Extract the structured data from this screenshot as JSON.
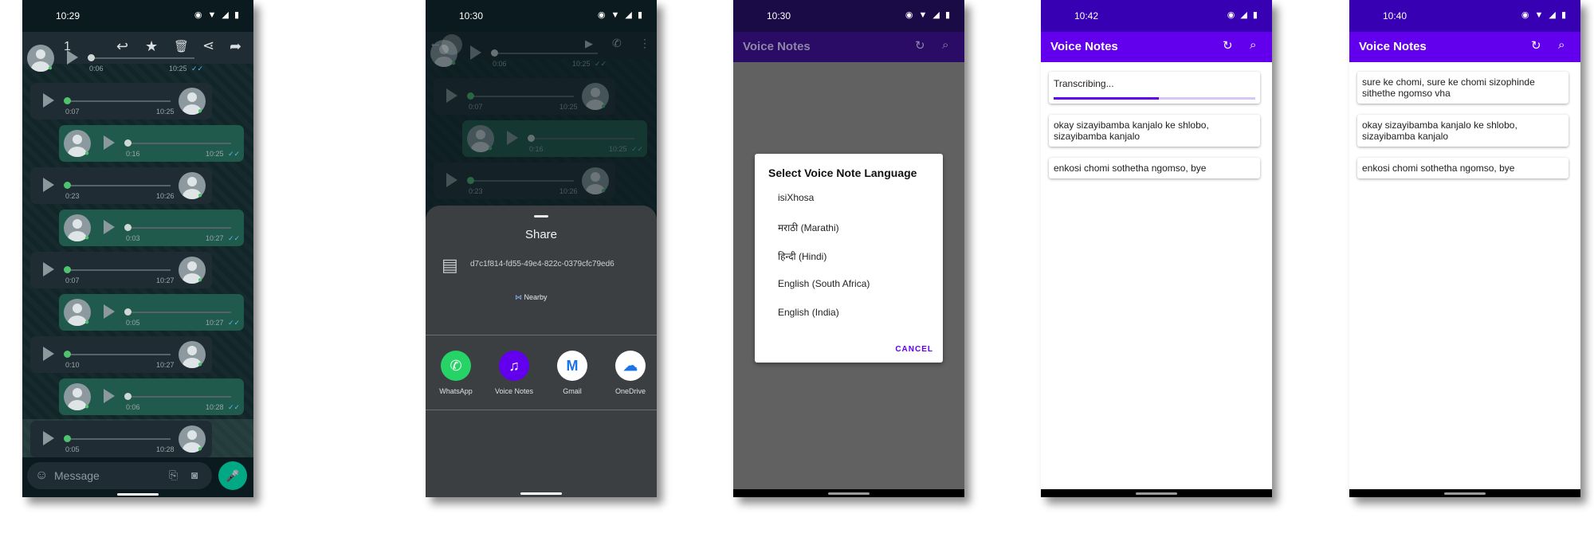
{
  "phone1": {
    "time": "10:29",
    "status_icons": "◉ ▼ ◢ ▮",
    "selected_count": "1",
    "message_placeholder": "Message",
    "partial_top": {
      "duration": "0:06",
      "time": "10:25"
    },
    "voice_notes": [
      {
        "dir": "in",
        "duration": "0:07",
        "time": "10:25"
      },
      {
        "dir": "out",
        "duration": "0:16",
        "time": "10:25"
      },
      {
        "dir": "in",
        "duration": "0:23",
        "time": "10:26"
      },
      {
        "dir": "out",
        "duration": "0:03",
        "time": "10:27"
      },
      {
        "dir": "in",
        "duration": "0:07",
        "time": "10:27"
      },
      {
        "dir": "out",
        "duration": "0:05",
        "time": "10:27"
      },
      {
        "dir": "in",
        "duration": "0:10",
        "time": "10:27"
      },
      {
        "dir": "out",
        "duration": "0:06",
        "time": "10:28"
      },
      {
        "dir": "in",
        "duration": "0:05",
        "time": "10:28"
      }
    ]
  },
  "phone2": {
    "time": "10:30",
    "status_icons": "◉ ▼ ◢ ▮",
    "share_title": "Share",
    "file_name": "d7c1f814-fd55-49e4-822c-0379cfc79ed6",
    "nearby_label": "Nearby",
    "partial_top": {
      "duration": "0:06",
      "time": "10:25"
    },
    "voice_notes": [
      {
        "dir": "in",
        "duration": "0:07",
        "time": "10:25"
      },
      {
        "dir": "out",
        "duration": "0:16",
        "time": "10:25"
      },
      {
        "dir": "in",
        "duration": "0:23",
        "time": "10:26"
      }
    ],
    "apps": [
      {
        "label": "WhatsApp",
        "color": "#25d366",
        "glyph": "✆"
      },
      {
        "label": "Voice Notes",
        "color": "#6200ee",
        "glyph": "♫"
      },
      {
        "label": "Gmail",
        "color": "#ffffff",
        "glyph": "M"
      },
      {
        "label": "OneDrive",
        "color": "#ffffff",
        "glyph": "☁"
      }
    ]
  },
  "phone3": {
    "time": "10:30",
    "status_icons": "◉ ▼ ◢ ▮",
    "app_title": "Voice Notes",
    "dialog_title": "Select Voice Note Language",
    "options": [
      "isiXhosa",
      "मराठी (Marathi)",
      "हिन्दी (Hindi)",
      "English (South Africa)",
      "English (India)"
    ],
    "cancel": "CANCEL"
  },
  "phone4": {
    "time": "10:42",
    "status_icons": "◉ ◢ ▮",
    "app_title": "Voice Notes",
    "transcribing": "Transcribing...",
    "progress": 0.52,
    "notes": [
      "okay sizayibamba kanjalo ke shlobo, sizayibamba kanjalo",
      "enkosi chomi sothetha ngomso, bye"
    ]
  },
  "phone5": {
    "time": "10:40",
    "status_icons": "◉ ▼ ◢ ▮",
    "app_title": "Voice Notes",
    "notes": [
      "sure ke chomi, sure ke chomi sizophinde sithethe ngomso vha",
      "okay sizayibamba kanjalo ke shlobo, sizayibamba kanjalo",
      "enkosi chomi sothetha ngomso, bye"
    ]
  },
  "colors": {
    "accent": "#6200ee",
    "accent_dark": "#3700b3",
    "wa_green": "#00a884",
    "wa_dot": "#4fc36d"
  },
  "icons": {
    "back": "←",
    "reply": "↩",
    "star": "★",
    "delete": "🗑",
    "share": "⋖",
    "forward": "➦",
    "refresh": "↻",
    "search": "⌕",
    "emoji": "☺",
    "attach": "⎘",
    "camera": "◙",
    "mic": "🎤",
    "video": "▶",
    "call": "✆",
    "more": "⋮",
    "file": "▤"
  }
}
